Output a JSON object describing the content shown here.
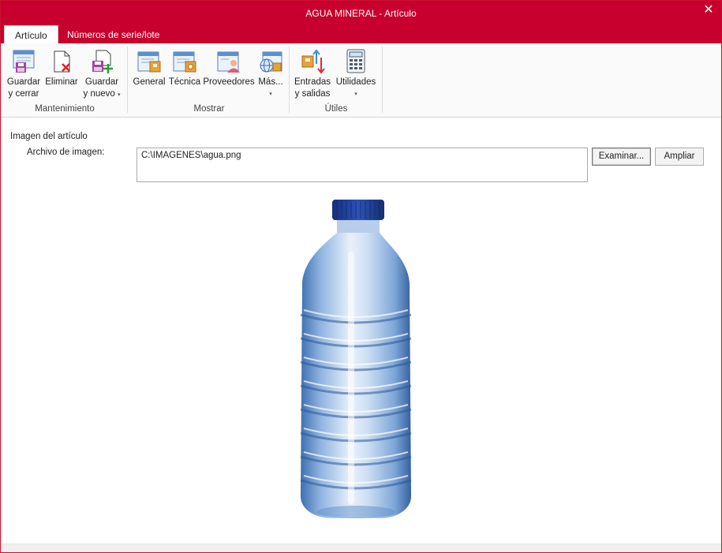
{
  "window": {
    "title": "AGUA MINERAL - Artículo",
    "close_glyph": "✕"
  },
  "tabs": [
    {
      "label": "Artículo",
      "active": true
    },
    {
      "label": "Números de serie/lote",
      "active": false
    }
  ],
  "ribbon": {
    "groups": [
      {
        "label": "Mantenimiento",
        "buttons": [
          {
            "icon": "save-close-icon",
            "line1": "Guardar",
            "line2": "y cerrar"
          },
          {
            "icon": "delete-icon",
            "line1": "Eliminar",
            "line2": ""
          },
          {
            "icon": "save-new-icon",
            "line1": "Guardar",
            "line2": "y nuevo",
            "has_dropdown": true
          }
        ]
      },
      {
        "label": "Mostrar",
        "buttons": [
          {
            "icon": "general-icon",
            "line1": "General",
            "line2": ""
          },
          {
            "icon": "technical-icon",
            "line1": "Técnica",
            "line2": ""
          },
          {
            "icon": "suppliers-icon",
            "line1": "Proveedores",
            "line2": ""
          },
          {
            "icon": "more-icon",
            "line1": "Más...",
            "line2": "",
            "has_dropdown": true
          }
        ]
      },
      {
        "label": "Útiles",
        "buttons": [
          {
            "icon": "inputs-outputs-icon",
            "line1": "Entradas",
            "line2": "y salidas"
          },
          {
            "icon": "calculator-icon",
            "line1": "Utilidades",
            "line2": "",
            "has_dropdown": true
          }
        ]
      }
    ],
    "dropdown_caret": "▾"
  },
  "content": {
    "section_title": "Imagen del artículo",
    "field_label": "Archivo de imagen:",
    "file_path": "C:\\IMAGENES\\agua.png",
    "browse_button": "Examinar...",
    "enlarge_button": "Ampliar",
    "preview_image": "water-bottle"
  },
  "colors": {
    "accent": "#c8002d",
    "ribbon_bg": "#fafafa",
    "bottle_cap": "#1f3f9a",
    "bottle_water": "#5f8fc8"
  }
}
